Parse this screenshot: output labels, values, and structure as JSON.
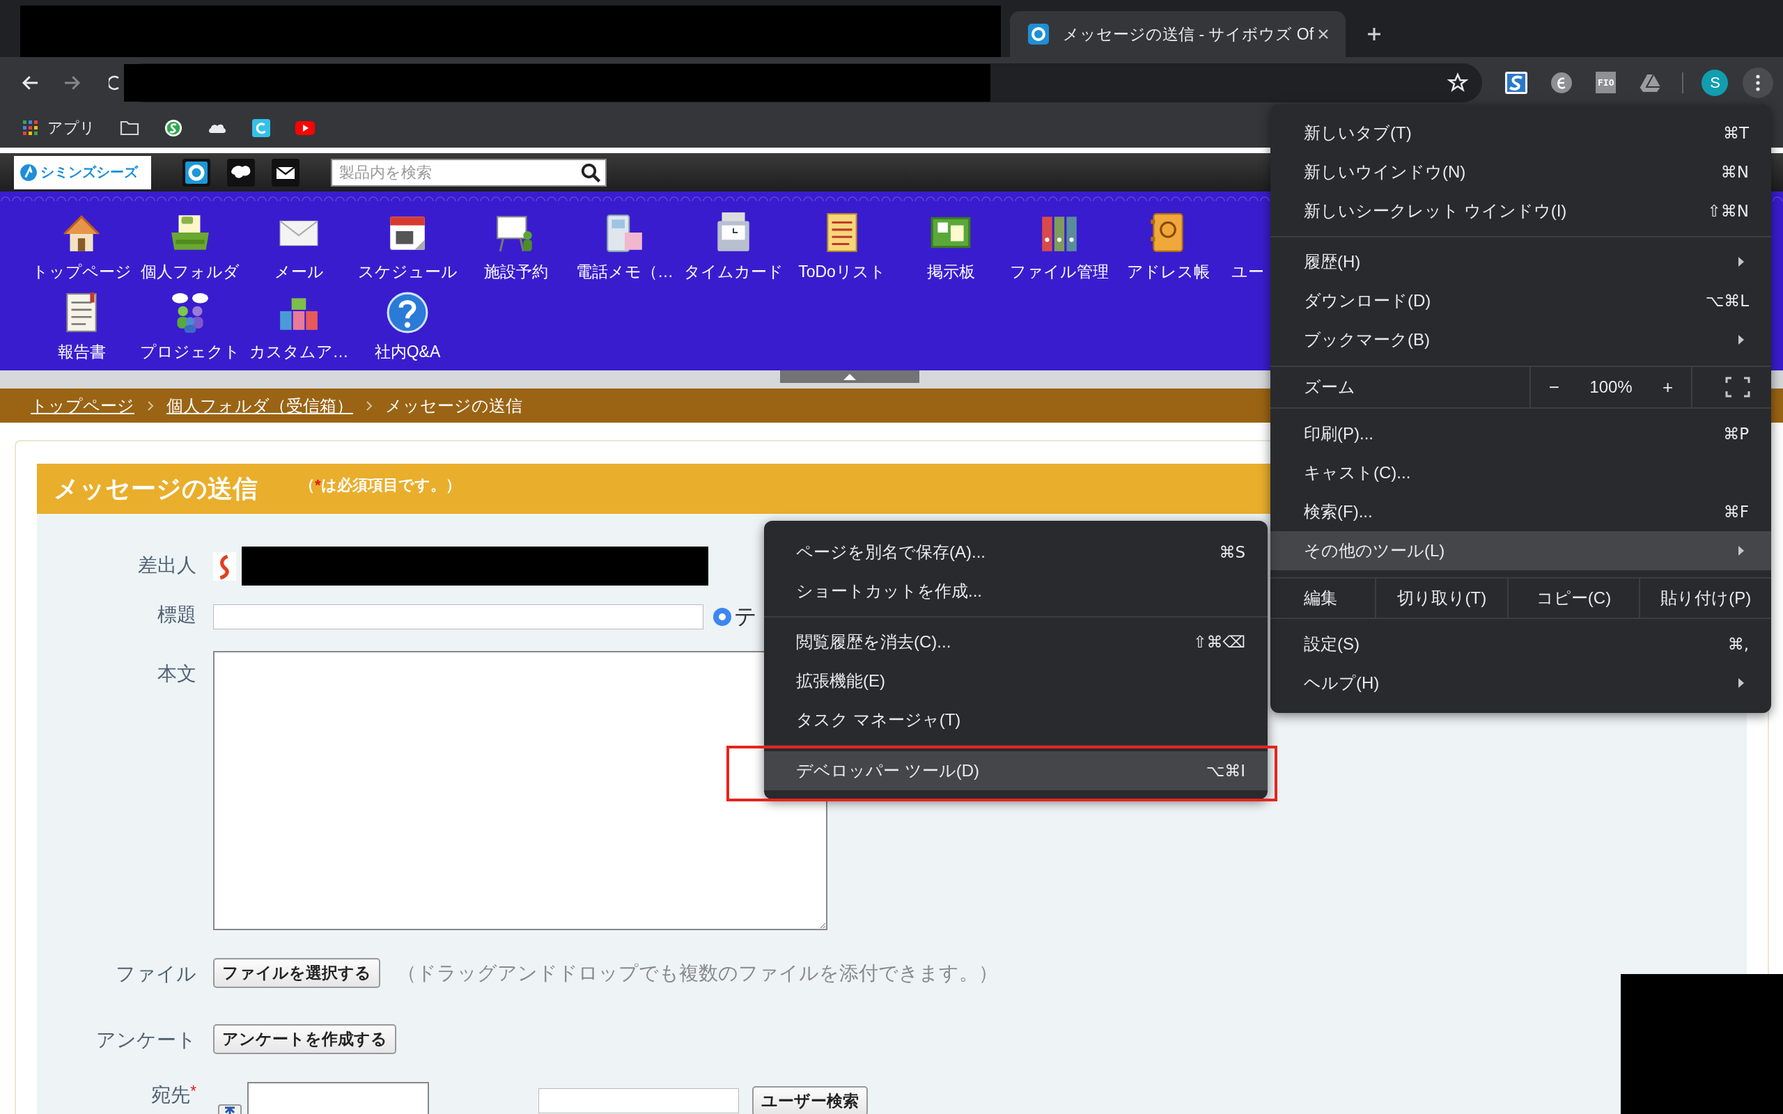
{
  "browser": {
    "tab": {
      "title": "メッセージの送信 - サイボウズ Of"
    },
    "extension_text": "FIO",
    "profile_initial": "S",
    "bookmarks": [
      {
        "kind": "apps",
        "label": "アプリ"
      },
      {
        "kind": "folder"
      },
      {
        "kind": "coin"
      },
      {
        "kind": "cloud"
      },
      {
        "kind": "tile"
      },
      {
        "kind": "play"
      }
    ]
  },
  "portal": {
    "logo": "シミンズシーズ",
    "search": {
      "placeholder": "製品内を検索"
    },
    "apps": [
      {
        "kind": "house",
        "label": "トップページ"
      },
      {
        "kind": "tray",
        "label": "個人フォルダ"
      },
      {
        "kind": "envelope",
        "label": "メール"
      },
      {
        "kind": "calendar",
        "label": "スケジュール"
      },
      {
        "kind": "whiteboard",
        "label": "施設予約"
      },
      {
        "kind": "phone",
        "label": "電話メモ（…"
      },
      {
        "kind": "timecard",
        "label": "タイムカード"
      },
      {
        "kind": "checklist",
        "label": "ToDoリスト"
      },
      {
        "kind": "board",
        "label": "掲示板"
      },
      {
        "kind": "binders",
        "label": "ファイル管理"
      },
      {
        "kind": "addressbook",
        "label": "アドレス帳"
      },
      {
        "kind": "cut",
        "label": "ユー"
      },
      {
        "kind": "report",
        "label": "報告書"
      },
      {
        "kind": "people",
        "label": "プロジェクト"
      },
      {
        "kind": "blocks",
        "label": "カスタムア…"
      },
      {
        "kind": "question",
        "label": "社内Q&A"
      }
    ],
    "breadcrumb": [
      {
        "label": "トップページ",
        "link": true
      },
      {
        "label": "個人フォルダ（受信箱）",
        "link": true
      },
      {
        "label": "メッセージの送信",
        "link": false
      }
    ]
  },
  "form": {
    "title": "メッセージの送信",
    "required_note": {
      "before": "（",
      "mark": "*",
      "after": "は必須項目です。）"
    },
    "fields": [
      {
        "kind": "sender",
        "label": "差出人"
      },
      {
        "kind": "subject",
        "label": "標題",
        "option": {
          "label": "テ",
          "checked": true
        }
      },
      {
        "kind": "body",
        "label": "本文"
      },
      {
        "kind": "file",
        "label": "ファイル",
        "button": "ファイルを選択する",
        "hint": "（ドラッグアンドドロップでも複数のファイルを添付できます。）"
      },
      {
        "kind": "survey",
        "label": "アンケート",
        "button": "アンケートを作成する"
      },
      {
        "kind": "recipients",
        "label": "宛先",
        "required_mark": "*",
        "button": "ユーザー検索"
      }
    ]
  },
  "chrome_menu": {
    "items": [
      {
        "kind": "item",
        "label": "新しいタブ(T)",
        "shortcut": "⌘T",
        "selected": false
      },
      {
        "kind": "item",
        "label": "新しいウインドウ(N)",
        "shortcut": "⌘N",
        "selected": false
      },
      {
        "kind": "item",
        "label": "新しいシークレット ウインドウ(I)",
        "shortcut": "⇧⌘N",
        "selected": false
      },
      {
        "kind": "separator"
      },
      {
        "kind": "item",
        "label": "履歴(H)",
        "submenu": true,
        "selected": false
      },
      {
        "kind": "item",
        "label": "ダウンロード(D)",
        "shortcut": "⌥⌘L",
        "selected": false
      },
      {
        "kind": "item",
        "label": "ブックマーク(B)",
        "submenu": true,
        "selected": false
      },
      {
        "kind": "zoom",
        "label": "ズーム",
        "minus": "−",
        "value": "100%",
        "plus": "+"
      },
      {
        "kind": "item",
        "label": "印刷(P)...",
        "shortcut": "⌘P",
        "selected": false
      },
      {
        "kind": "item",
        "label": "キャスト(C)...",
        "selected": false
      },
      {
        "kind": "item",
        "label": "検索(F)...",
        "shortcut": "⌘F",
        "selected": false
      },
      {
        "kind": "item",
        "label": "その他のツール(L)",
        "submenu": true,
        "selected": true
      },
      {
        "kind": "edit",
        "label": "編集",
        "actions": [
          "切り取り(T)",
          "コピー(C)",
          "貼り付け(P)"
        ]
      },
      {
        "kind": "item",
        "label": "設定(S)",
        "shortcut": "⌘,",
        "selected": false
      },
      {
        "kind": "item",
        "label": "ヘルプ(H)",
        "submenu": true,
        "selected": false
      }
    ]
  },
  "tools_submenu": {
    "items": [
      {
        "kind": "item",
        "label": "ページを別名で保存(A)...",
        "shortcut": "⌘S",
        "selected": false
      },
      {
        "kind": "item",
        "label": "ショートカットを作成...",
        "selected": false
      },
      {
        "kind": "separator"
      },
      {
        "kind": "item",
        "label": "閲覧履歴を消去(C)...",
        "shortcut": "⇧⌘⌫",
        "selected": false
      },
      {
        "kind": "item",
        "label": "拡張機能(E)",
        "selected": false
      },
      {
        "kind": "item",
        "label": "タスク マネージャ(T)",
        "selected": false
      },
      {
        "kind": "separator"
      },
      {
        "kind": "item",
        "label": "デベロッパー ツール(D)",
        "shortcut": "⌥⌘I",
        "selected": true
      }
    ]
  }
}
